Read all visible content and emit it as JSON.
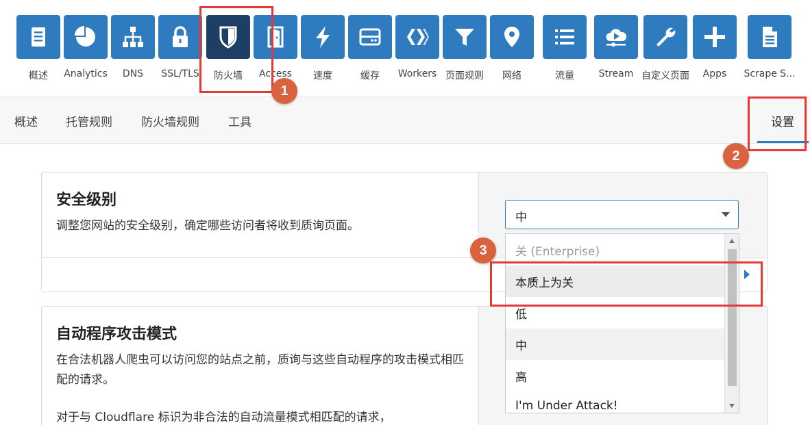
{
  "apps": [
    {
      "label": "概述",
      "icon": "document-icon"
    },
    {
      "label": "Analytics",
      "icon": "pie-chart-icon"
    },
    {
      "label": "DNS",
      "icon": "sitemap-icon"
    },
    {
      "label": "SSL/TLS",
      "icon": "lock-icon"
    },
    {
      "label": "防火墙",
      "icon": "shield-icon",
      "active": true
    },
    {
      "label": "Access",
      "icon": "door-icon"
    },
    {
      "label": "速度",
      "icon": "bolt-icon"
    },
    {
      "label": "缓存",
      "icon": "drive-icon"
    },
    {
      "label": "Workers",
      "icon": "workers-icon"
    },
    {
      "label": "页面规则",
      "icon": "filter-icon"
    },
    {
      "label": "网络",
      "icon": "location-pin-icon"
    },
    {
      "label": "流量",
      "icon": "list-icon"
    },
    {
      "label": "Stream",
      "icon": "cloud-play-icon"
    },
    {
      "label": "自定义页面",
      "icon": "wrench-icon"
    },
    {
      "label": "Apps",
      "icon": "plus-icon"
    },
    {
      "label": "Scrape S...",
      "icon": "file-icon"
    }
  ],
  "subnav": {
    "tabs": [
      "概述",
      "托管规则",
      "防火墙规则",
      "工具"
    ],
    "settings": "设置"
  },
  "security_level": {
    "title": "安全级别",
    "description": "调整您网站的安全级别，确定哪些访问者将收到质询页面。",
    "selected": "中",
    "options": [
      "关 (Enterprise)",
      "本质上为关",
      "低",
      "中",
      "高",
      "I'm Under Attack!"
    ]
  },
  "bot_fight": {
    "title": "自动程序攻击模式",
    "description": "在合法机器人爬虫可以访问您的站点之前，质询与这些自动程序的攻击模式相匹配的请求。",
    "description2": "对于与 Cloudflare 标识为非合法的自动流量模式相匹配的请求，"
  },
  "annotations": [
    "1",
    "2",
    "3"
  ],
  "colors": {
    "accent": "#2f7bbf",
    "active_tile": "#1d3f66",
    "annotation_red": "#e53935",
    "badge": "#d9623f"
  }
}
